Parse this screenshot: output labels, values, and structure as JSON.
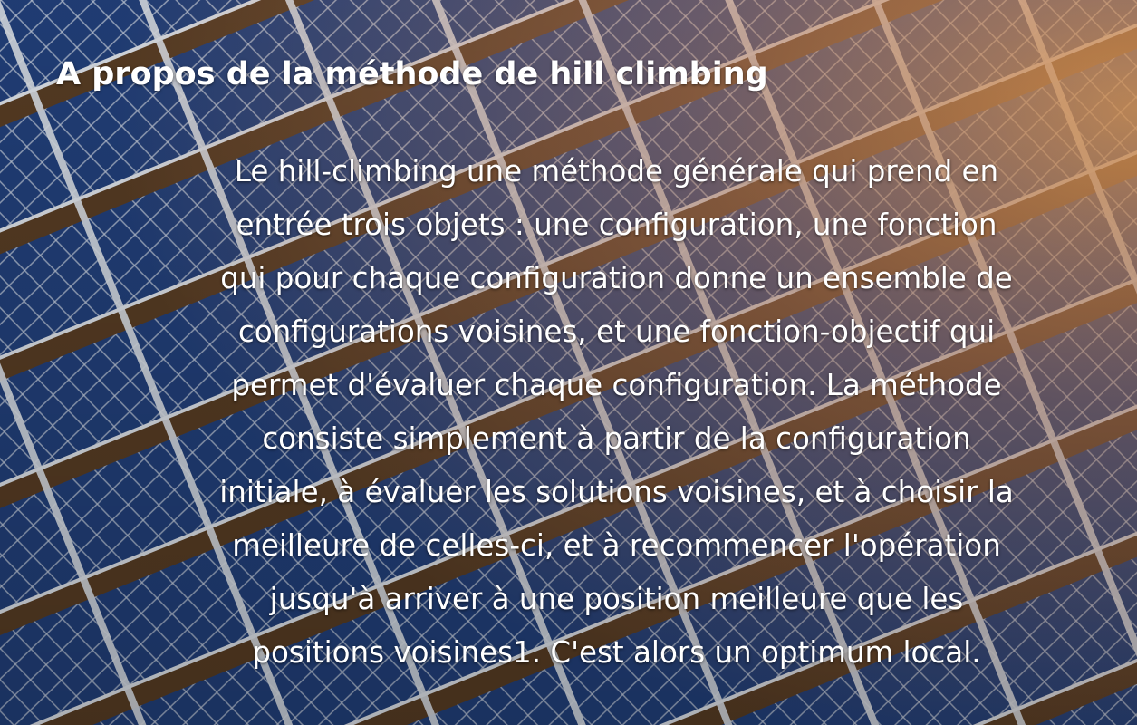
{
  "slide": {
    "title": "A propos de la méthode de hill climbing",
    "body_lines": [
      "Le hill-climbing une méthode générale qui prend en",
      "entrée trois objets : une configuration, une fonction",
      "qui pour chaque configuration donne un ensemble de",
      "configurations voisines, et une fonction-objectif qui",
      "permet d'évaluer chaque configuration. La méthode",
      "consiste simplement à partir de la configuration",
      "initiale, à évaluer les solutions voisines, et à choisir la",
      "meilleure de celles-ci, et à recommencer l'opération",
      "jusqu'à arriver à une position meilleure que les",
      "positions voisines1. C'est alors un optimum local."
    ]
  },
  "colors": {
    "text": "#ffffff",
    "panel_blue": "#1f3d7a",
    "panel_frame": "#d7dde6",
    "ground": "#7a5634",
    "sunlight": "#e3a06a"
  },
  "background": {
    "image": "solar-panels-photo"
  }
}
